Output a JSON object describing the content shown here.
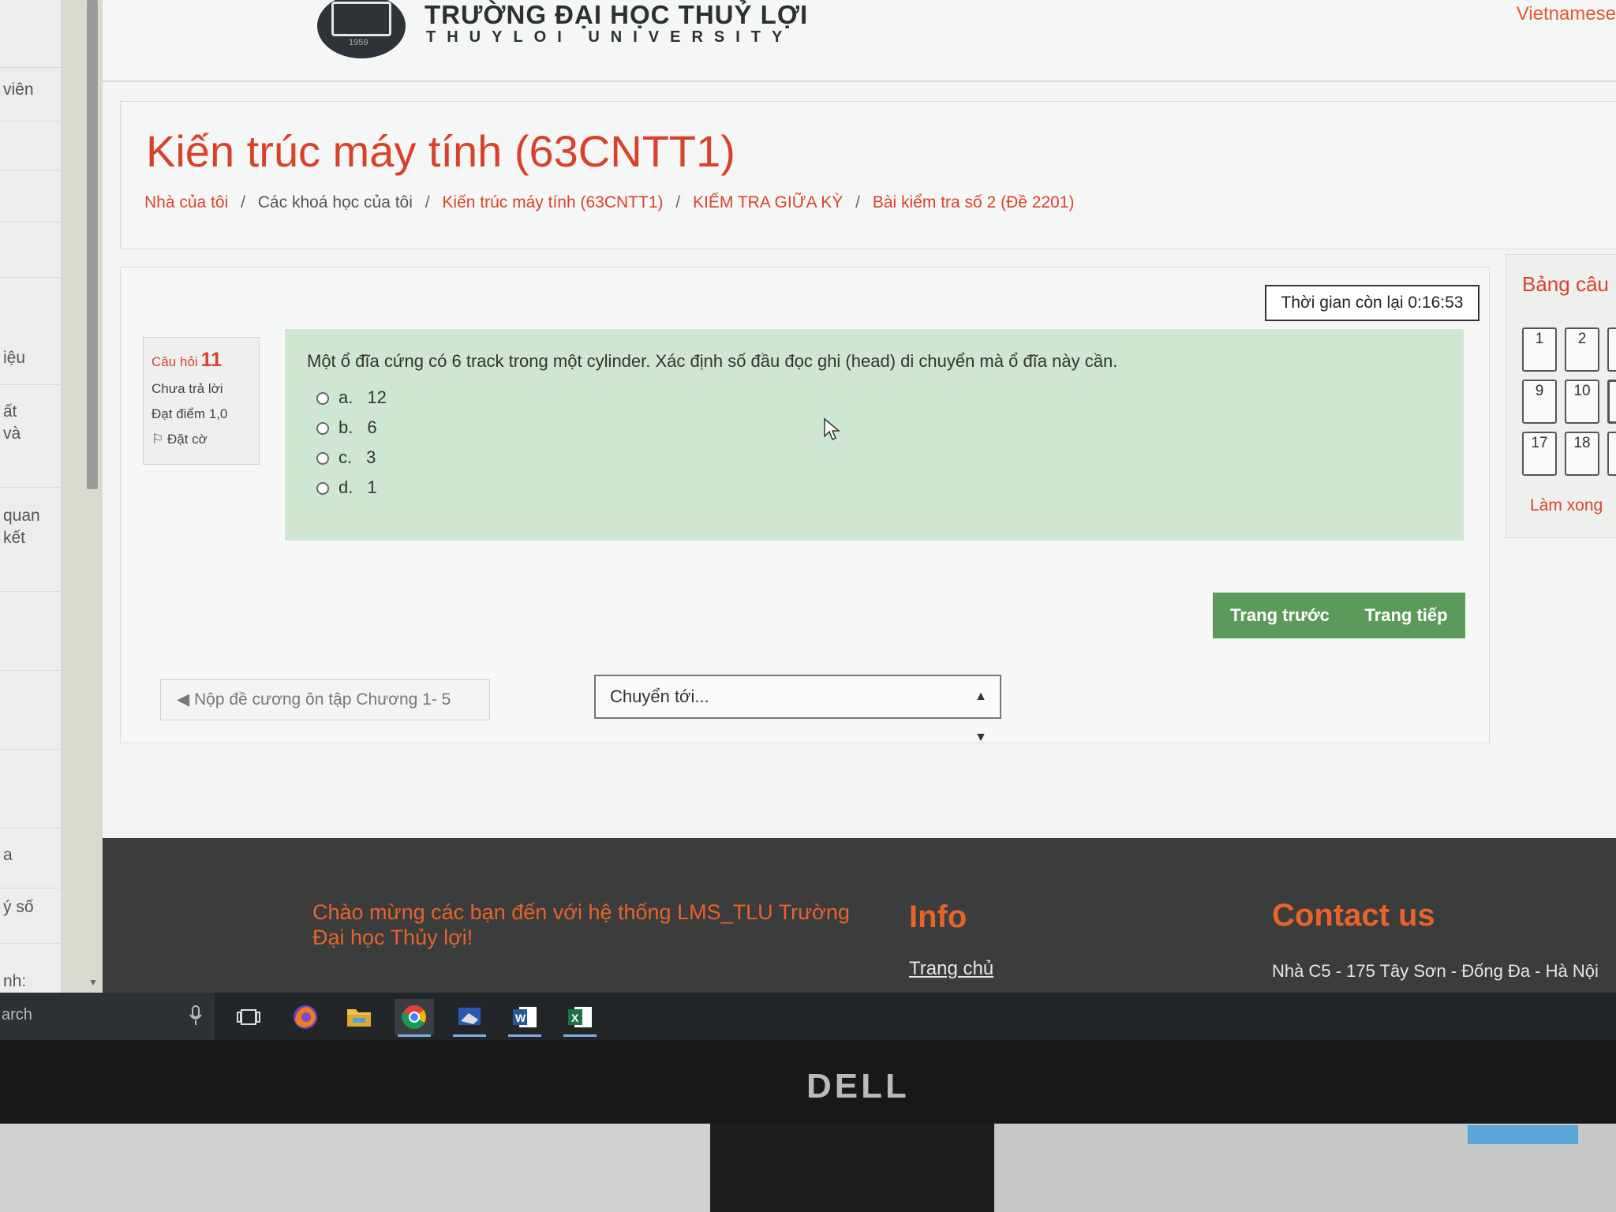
{
  "sidebar": {
    "items": [
      "viên",
      "iệu",
      "ất\nvà",
      "quan\nkết",
      "a",
      "ý số",
      "nh:"
    ]
  },
  "header": {
    "university_name": "TRƯỜNG ĐẠI HỌC THUỶ LỢI",
    "university_sub": "THUYLOI UNIVERSITY",
    "logo_year": "1959",
    "language": "Vietnamese"
  },
  "course": {
    "title": "Kiến trúc máy tính (63CNTT1)",
    "breadcrumb": [
      "Nhà của tôi",
      "Các khoá học của tôi",
      "Kiến trúc máy tính (63CNTT1)",
      "KIỂM TRA GIỮA KỲ",
      "Bài kiểm tra số 2 (Đề 2201)"
    ]
  },
  "quiz": {
    "timer": "Thời gian còn lại 0:16:53",
    "question_info": {
      "label": "Câu hỏi",
      "number": "11",
      "status": "Chưa trả lời",
      "marks": "Đạt điểm 1,0",
      "flag": "Đặt cờ"
    },
    "question_text": "Một ổ đĩa cứng có 6 track trong một cylinder. Xác định số đầu đọc ghi (head) di chuyển mà ổ đĩa này cần.",
    "options": [
      {
        "letter": "a.",
        "value": "12"
      },
      {
        "letter": "b.",
        "value": "6"
      },
      {
        "letter": "c.",
        "value": "3"
      },
      {
        "letter": "d.",
        "value": "1"
      }
    ],
    "prev_page": "Trang trước",
    "next_page": "Trang tiếp",
    "prev_activity": "◀ Nộp đề cương ôn tập Chương 1- 5",
    "jump_to": "Chuyển tới..."
  },
  "question_nav": {
    "title": "Bảng câu",
    "boxes": [
      "1",
      "2",
      "9",
      "10",
      "17",
      "18"
    ],
    "finish": "Làm xong"
  },
  "footer": {
    "welcome": "Chào mừng các bạn đến với hệ thống LMS_TLU Trường Đại học Thủy lợi!",
    "info_title": "Info",
    "home_link": "Trang chủ",
    "contact_title": "Contact us",
    "address": "Nhà C5 - 175 Tây Sơn - Đống Đa - Hà Nội"
  },
  "taskbar": {
    "search_text": "arch",
    "apps": [
      "firefox-icon",
      "file-explorer-icon",
      "chrome-icon",
      "app-icon",
      "word-icon",
      "excel-icon"
    ]
  },
  "monitor": {
    "brand": "DELL"
  },
  "colors": {
    "accent": "#d9422a",
    "question_bg": "#cfe6d3",
    "button_green": "#5c9a5a",
    "footer_bg": "#3a3d3c",
    "footer_accent": "#e8632a"
  }
}
